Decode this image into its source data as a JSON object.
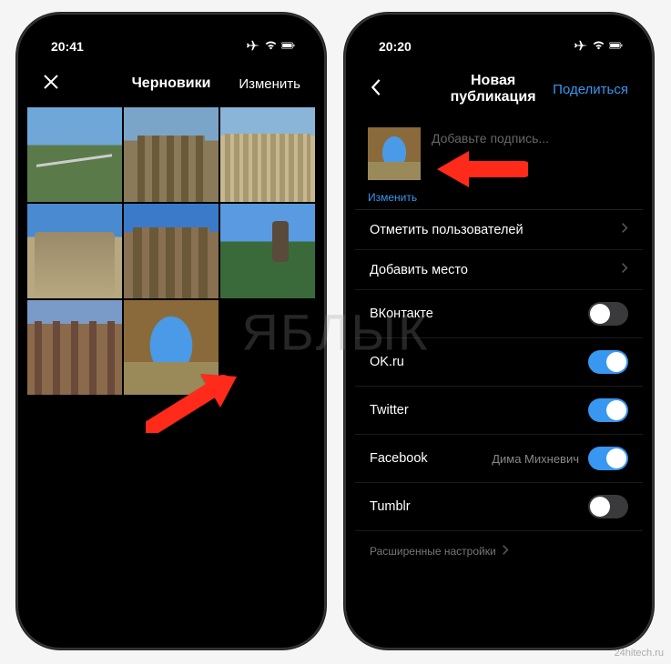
{
  "watermark_center": "ЯБЛЫК",
  "watermark_corner": "24hitech.ru",
  "left": {
    "status_time": "20:41",
    "nav_title": "Черновики",
    "nav_right": "Изменить"
  },
  "right": {
    "status_time": "20:20",
    "nav_title": "Новая публикация",
    "nav_right": "Поделиться",
    "caption_placeholder": "Добавьте подпись...",
    "edit_label": "Изменить",
    "rows": {
      "tag_users": "Отметить пользователей",
      "add_location": "Добавить место",
      "vk": "ВКонтакте",
      "ok": "OK.ru",
      "twitter": "Twitter",
      "facebook": "Facebook",
      "facebook_meta": "Дима Михневич",
      "tumblr": "Tumblr"
    },
    "toggles": {
      "vk": false,
      "ok": true,
      "twitter": true,
      "facebook": true,
      "tumblr": false
    },
    "advanced": "Расширенные настройки"
  }
}
